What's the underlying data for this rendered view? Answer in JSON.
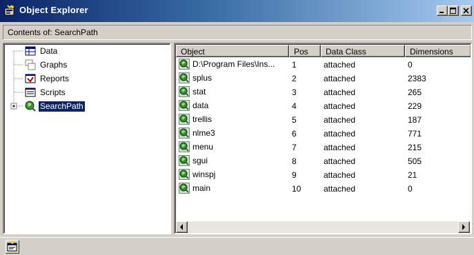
{
  "window": {
    "title": "Object Explorer"
  },
  "contents": {
    "label": "Contents of: SearchPath"
  },
  "tree": {
    "items": [
      {
        "label": "Data",
        "icon": "data-table-icon"
      },
      {
        "label": "Graphs",
        "icon": "graphs-icon"
      },
      {
        "label": "Reports",
        "icon": "reports-icon"
      },
      {
        "label": "Scripts",
        "icon": "scripts-icon"
      },
      {
        "label": "SearchPath",
        "icon": "searchpath-icon",
        "selected": true,
        "expander": "+"
      }
    ]
  },
  "list": {
    "columns": [
      "Object",
      "Pos",
      "Data Class",
      "Dimensions"
    ],
    "rows": [
      {
        "object": "D:\\Program Files\\Ins...",
        "pos": "1",
        "data_class": "attached",
        "dimensions": "0"
      },
      {
        "object": "splus",
        "pos": "2",
        "data_class": "attached",
        "dimensions": "2383"
      },
      {
        "object": "stat",
        "pos": "3",
        "data_class": "attached",
        "dimensions": "265"
      },
      {
        "object": "data",
        "pos": "4",
        "data_class": "attached",
        "dimensions": "229"
      },
      {
        "object": "trellis",
        "pos": "5",
        "data_class": "attached",
        "dimensions": "187"
      },
      {
        "object": "nlme3",
        "pos": "6",
        "data_class": "attached",
        "dimensions": "771"
      },
      {
        "object": "menu",
        "pos": "7",
        "data_class": "attached",
        "dimensions": "215"
      },
      {
        "object": "sgui",
        "pos": "8",
        "data_class": "attached",
        "dimensions": "505"
      },
      {
        "object": "winspj",
        "pos": "9",
        "data_class": "attached",
        "dimensions": "21"
      },
      {
        "object": "main",
        "pos": "10",
        "data_class": "attached",
        "dimensions": "0"
      }
    ]
  },
  "colors": {
    "title_start": "#0a246a",
    "title_end": "#a6caf0",
    "selection": "#0a246a",
    "face": "#d4d0c8"
  }
}
